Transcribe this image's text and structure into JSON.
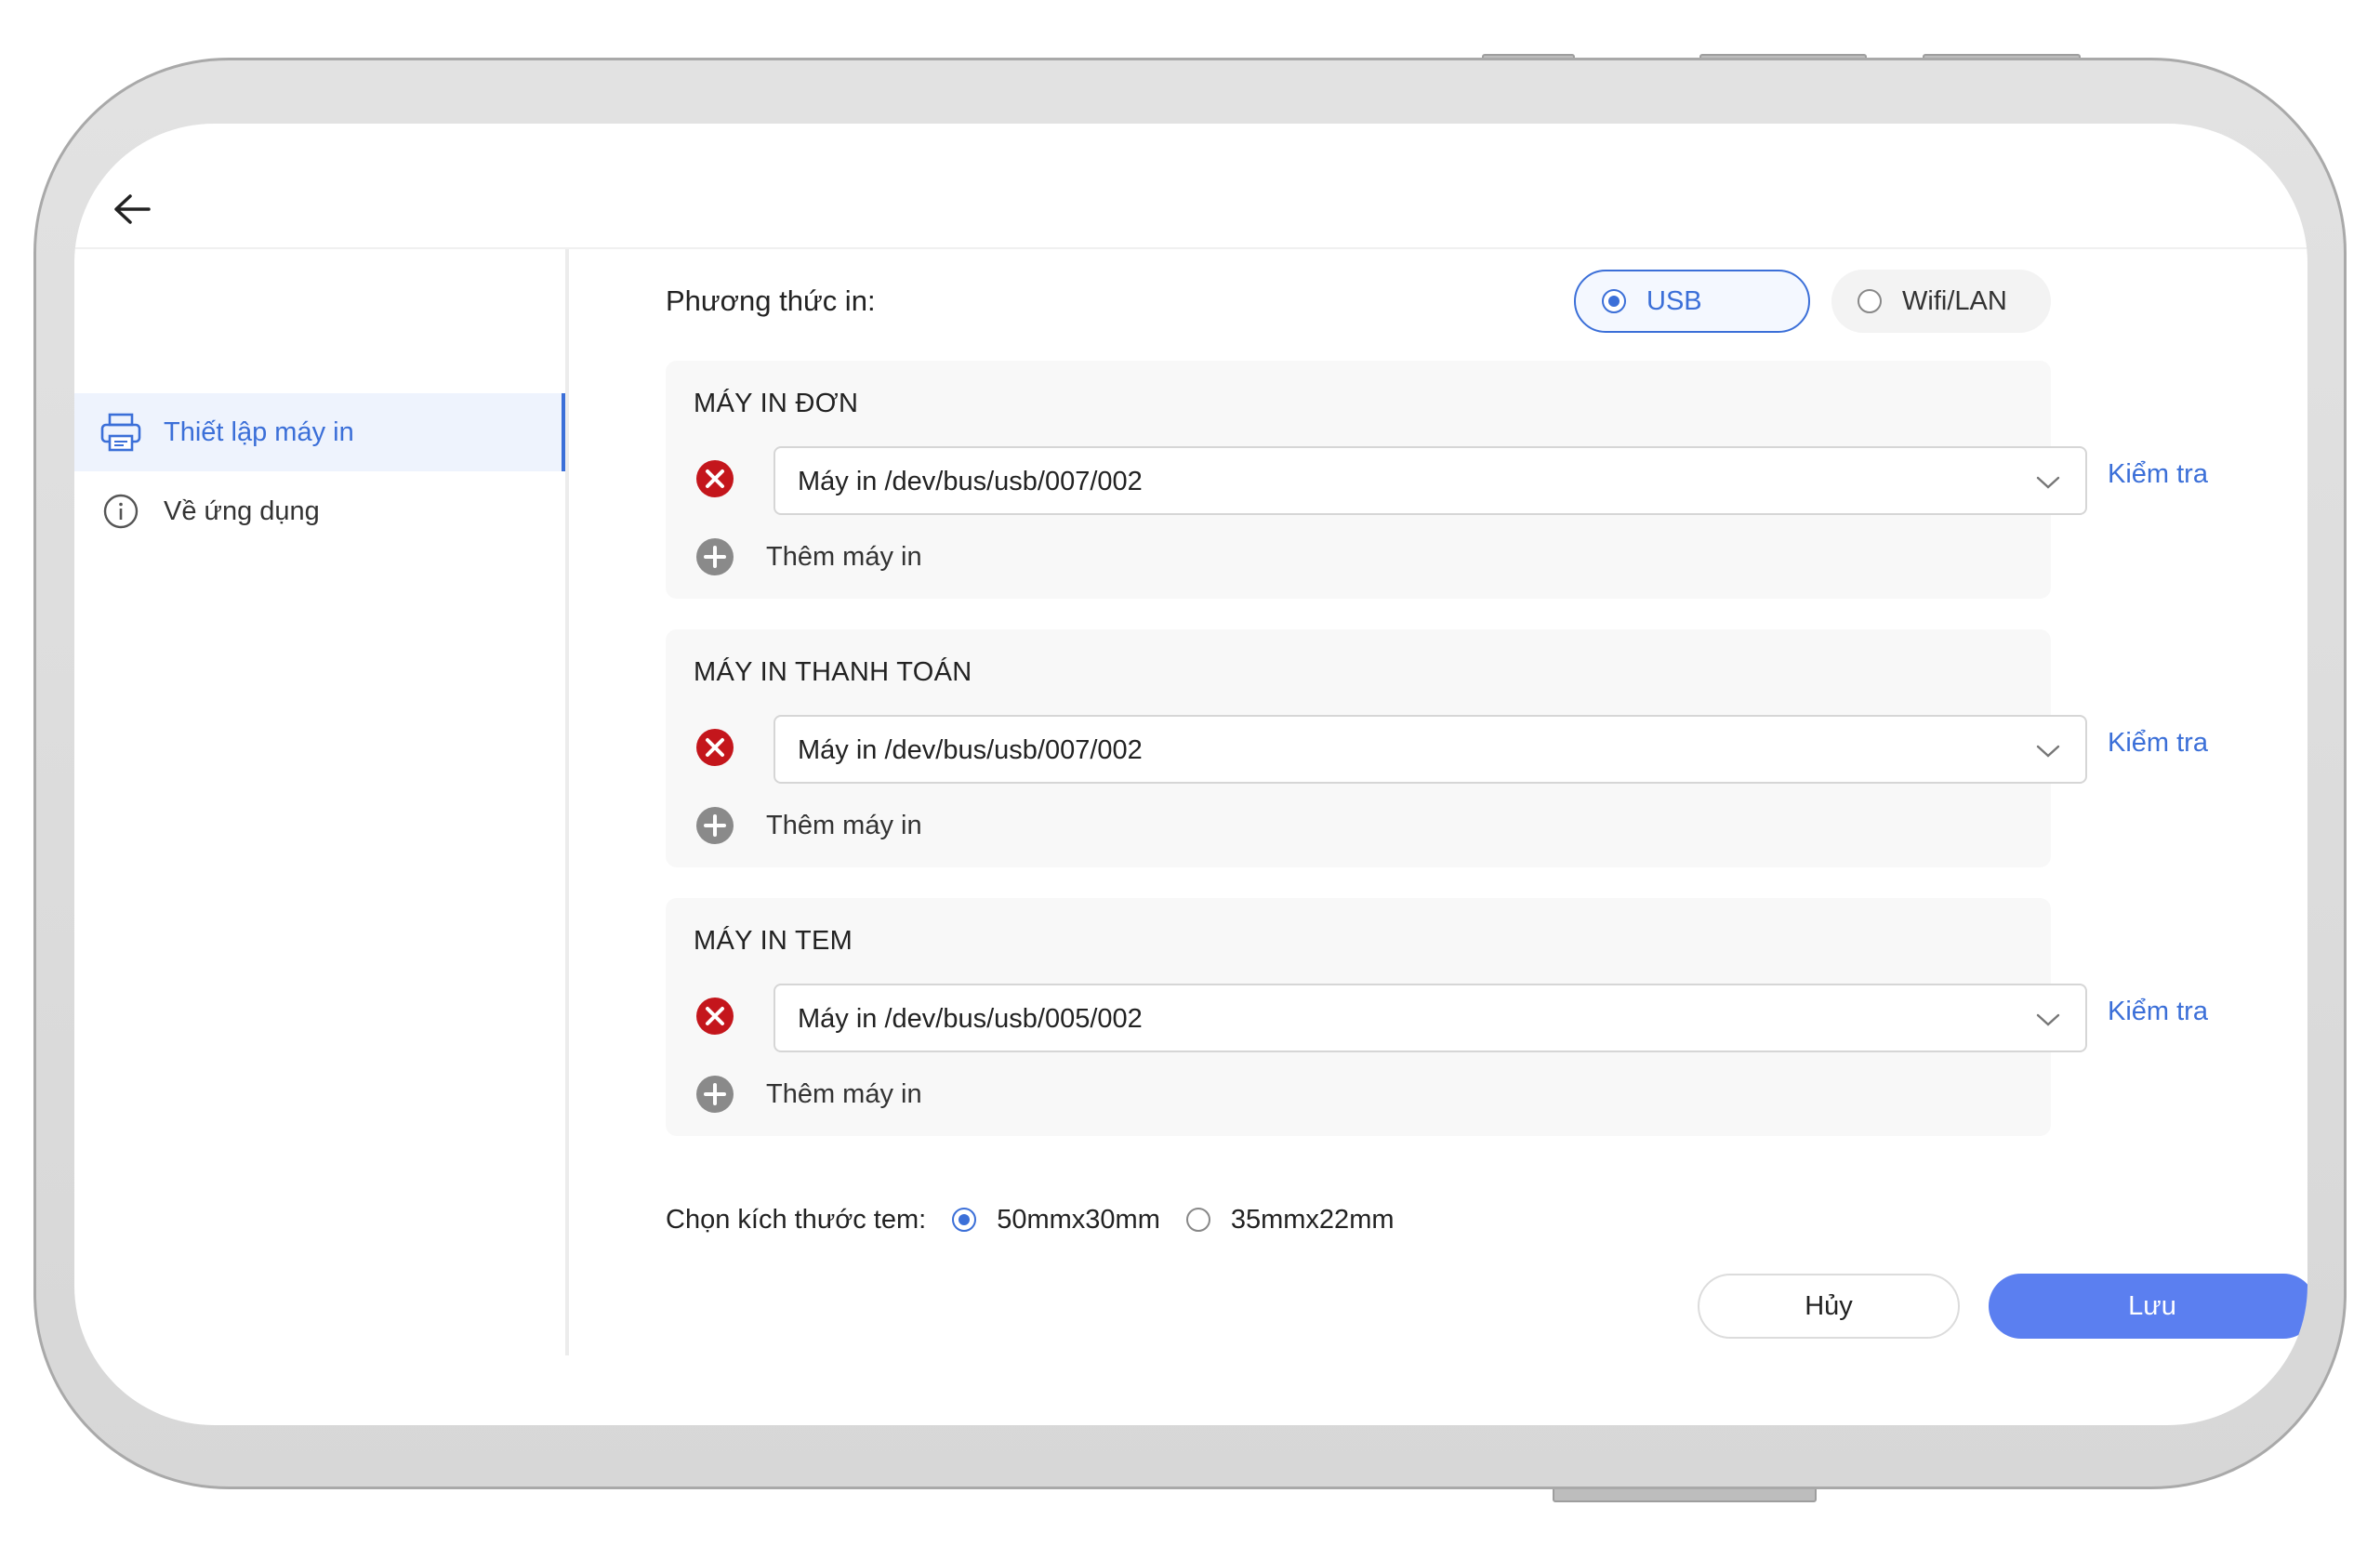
{
  "sidebar": {
    "items": [
      {
        "label": "Thiết lập máy in",
        "icon": "printer-icon",
        "active": true
      },
      {
        "label": "Về ứng dụng",
        "icon": "info-icon",
        "active": false
      }
    ]
  },
  "print_method": {
    "label": "Phương thức in:",
    "options": [
      {
        "label": "USB",
        "selected": true
      },
      {
        "label": "Wifi/LAN",
        "selected": false
      }
    ]
  },
  "sections": [
    {
      "title": "MÁY IN ĐƠN",
      "printer": "Máy in /dev/bus/usb/007/002",
      "check_label": "Kiểm tra",
      "add_label": "Thêm máy in"
    },
    {
      "title": "MÁY IN THANH TOÁN",
      "printer": "Máy in /dev/bus/usb/007/002",
      "check_label": "Kiểm tra",
      "add_label": "Thêm máy in"
    },
    {
      "title": "MÁY IN TEM",
      "printer": "Máy in /dev/bus/usb/005/002",
      "check_label": "Kiểm tra",
      "add_label": "Thêm máy in"
    }
  ],
  "label_size": {
    "label": "Chọn kích thước tem:",
    "options": [
      {
        "label": "50mmx30mm",
        "selected": true
      },
      {
        "label": "35mmx22mm",
        "selected": false
      }
    ]
  },
  "actions": {
    "cancel_label": "Hủy",
    "save_label": "Lưu"
  },
  "colors": {
    "accent": "#3b6fd8",
    "save_button": "#5b7ff0",
    "error": "#c4161c"
  }
}
